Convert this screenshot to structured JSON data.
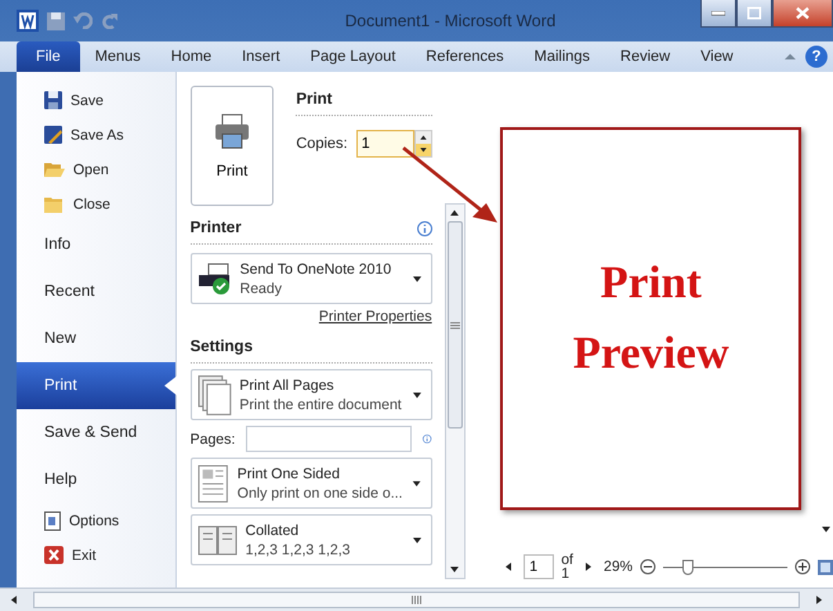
{
  "window": {
    "title": "Document1  -  Microsoft Word"
  },
  "tabs": [
    {
      "label": "File",
      "selected": true
    },
    {
      "label": "Menus",
      "selected": false
    },
    {
      "label": "Home",
      "selected": false
    },
    {
      "label": "Insert",
      "selected": false
    },
    {
      "label": "Page Layout",
      "selected": false
    },
    {
      "label": "References",
      "selected": false
    },
    {
      "label": "Mailings",
      "selected": false
    },
    {
      "label": "Review",
      "selected": false
    },
    {
      "label": "View",
      "selected": false
    }
  ],
  "help": {
    "label": "?"
  },
  "nav": [
    {
      "label": "Save",
      "kind": "command",
      "selected": false
    },
    {
      "label": "Save As",
      "kind": "command",
      "selected": false
    },
    {
      "label": "Open",
      "kind": "command",
      "selected": false
    },
    {
      "label": "Close",
      "kind": "command",
      "selected": false
    },
    {
      "label": "Info",
      "kind": "section",
      "selected": false
    },
    {
      "label": "Recent",
      "kind": "section",
      "selected": false
    },
    {
      "label": "New",
      "kind": "section",
      "selected": false
    },
    {
      "label": "Print",
      "kind": "section",
      "selected": true
    },
    {
      "label": "Save & Send",
      "kind": "section",
      "selected": false
    },
    {
      "label": "Help",
      "kind": "section",
      "selected": false
    },
    {
      "label": "Options",
      "kind": "command",
      "selected": false
    },
    {
      "label": "Exit",
      "kind": "command",
      "selected": false
    }
  ],
  "print_panel": {
    "print_button": "Print",
    "heading": "Print",
    "copies_label": "Copies:",
    "copies_value": "1",
    "printer_heading": "Printer",
    "printer_name": "Send To OneNote 2010",
    "printer_status": "Ready",
    "printer_properties": "Printer Properties",
    "settings_heading": "Settings",
    "settings": [
      {
        "kind": "dropdown",
        "title": "Print All Pages",
        "subtitle": "Print the entire document"
      },
      {
        "kind": "pages",
        "label": "Pages:"
      },
      {
        "kind": "dropdown",
        "title": "Print One Sided",
        "subtitle": "Only print on one side o..."
      },
      {
        "kind": "dropdown",
        "title": "Collated",
        "subtitle": "1,2,3   1,2,3   1,2,3"
      }
    ]
  },
  "preview": {
    "annotation": [
      "Print",
      "Preview"
    ],
    "page": "1",
    "of": "of",
    "total": "1",
    "zoom": "29%",
    "level": 0.2
  }
}
